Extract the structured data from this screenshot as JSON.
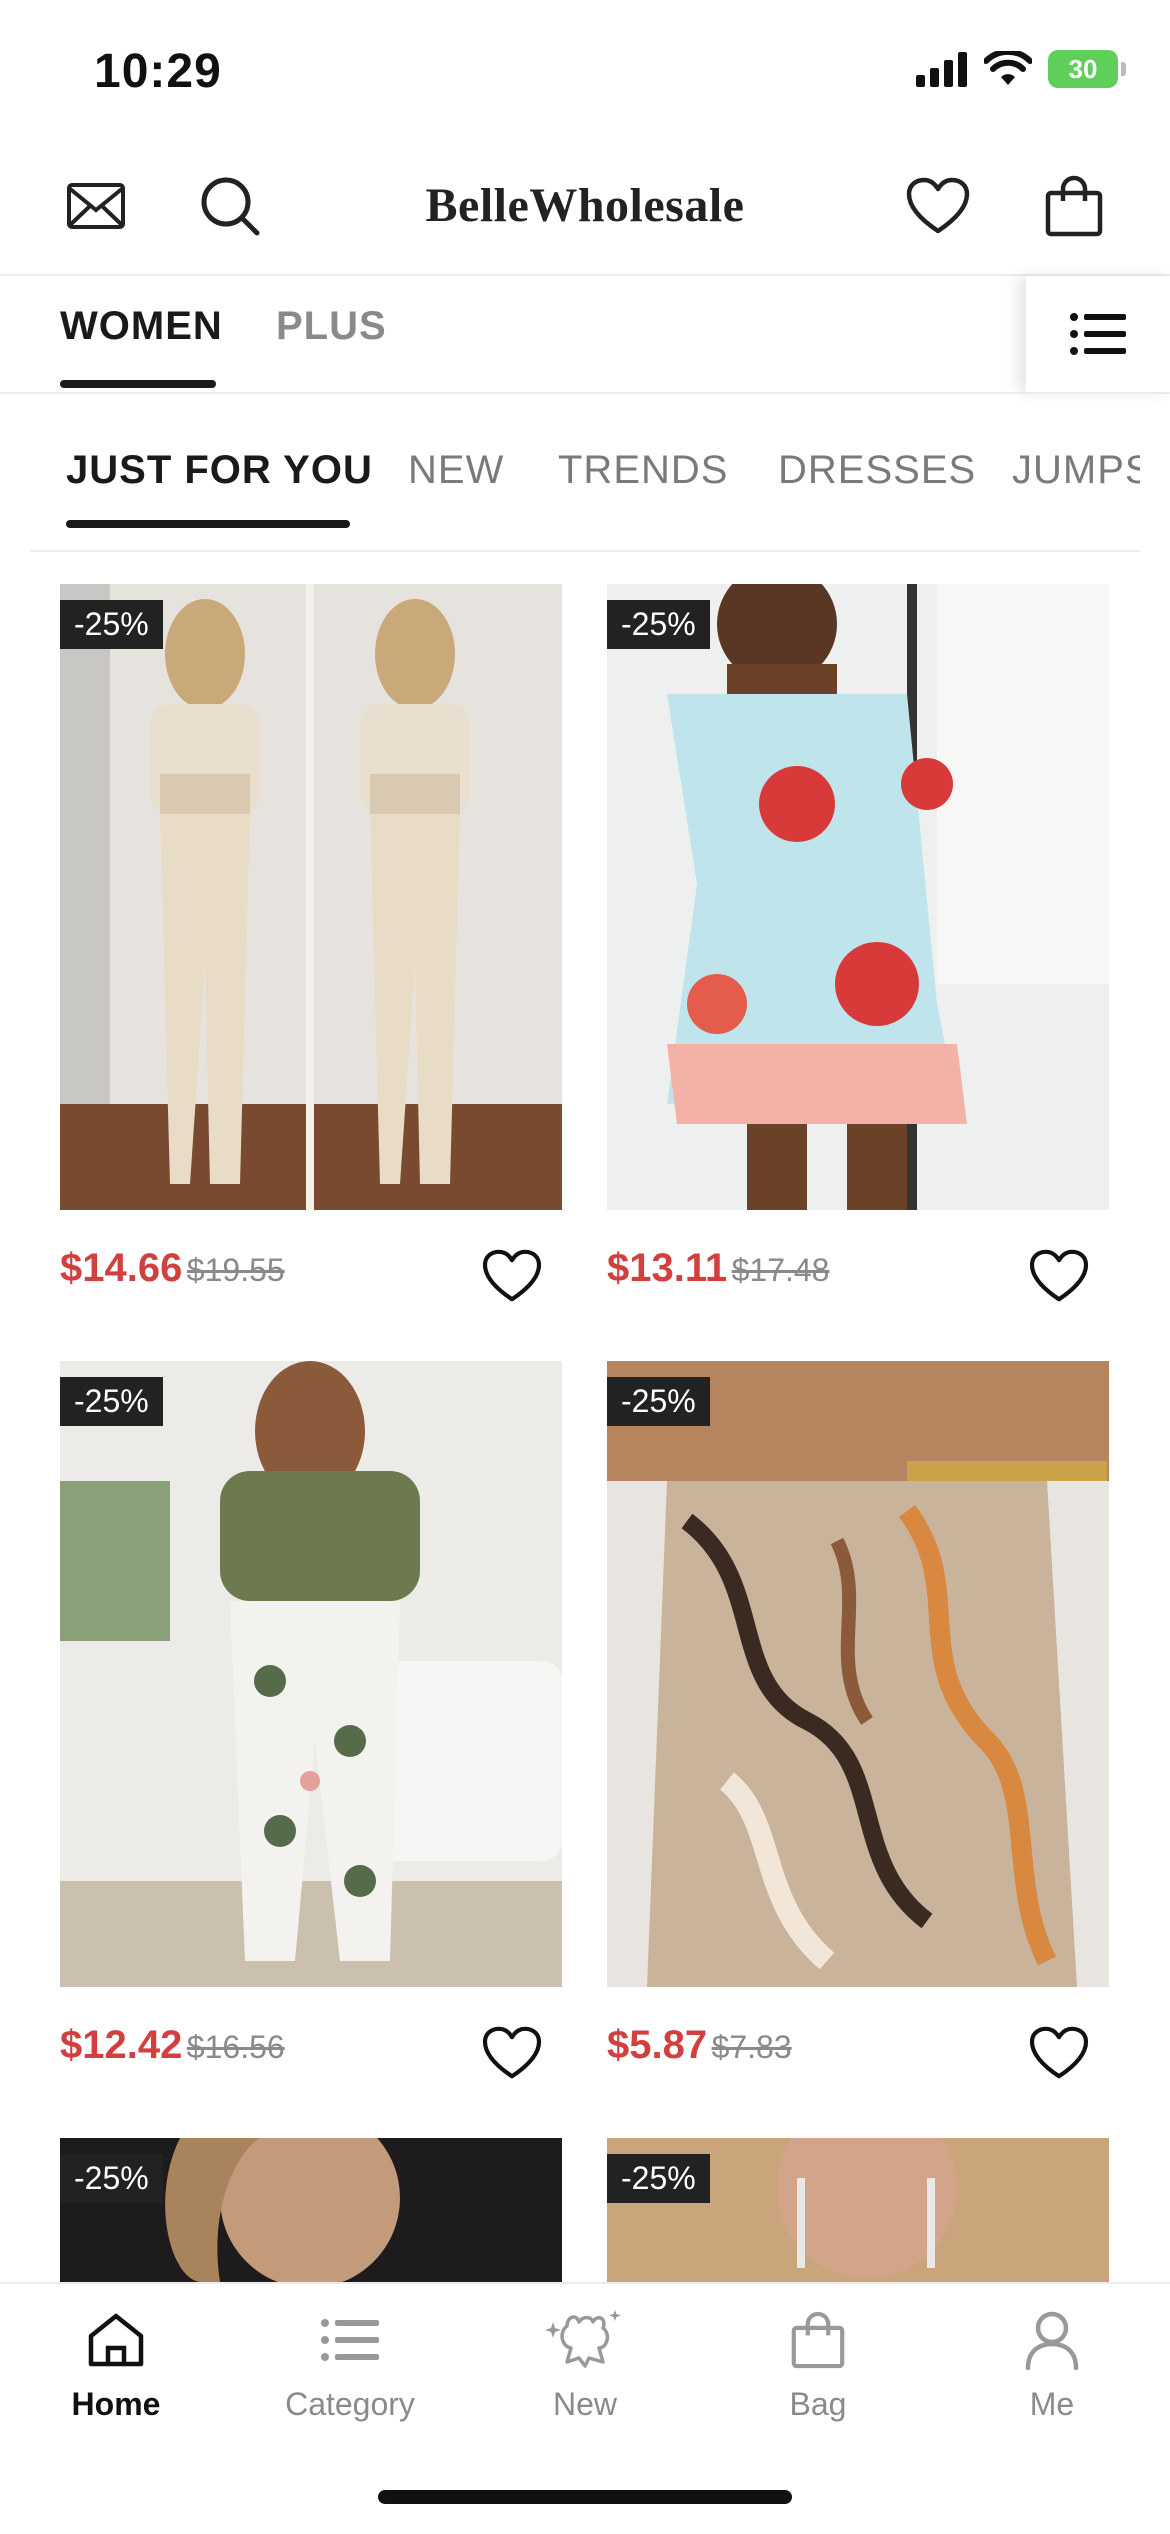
{
  "status_bar": {
    "time": "10:29",
    "battery": "30"
  },
  "header": {
    "brand": "BelleWholesale"
  },
  "gender_tabs": [
    {
      "label": "WOMEN"
    },
    {
      "label": "PLUS"
    }
  ],
  "category_tabs": [
    {
      "label": "JUST FOR YOU"
    },
    {
      "label": "NEW"
    },
    {
      "label": "TRENDS"
    },
    {
      "label": "DRESSES"
    },
    {
      "label": "JUMPS"
    }
  ],
  "products": [
    {
      "discount": "-25%",
      "price": "$14.66",
      "original_price": "$19.55"
    },
    {
      "discount": "-25%",
      "price": "$13.11",
      "original_price": "$17.48"
    },
    {
      "discount": "-25%",
      "price": "$12.42",
      "original_price": "$16.56"
    },
    {
      "discount": "-25%",
      "price": "$5.87",
      "original_price": "$7.83"
    },
    {
      "discount": "-25%"
    },
    {
      "discount": "-25%"
    }
  ],
  "bottom_nav": [
    {
      "label": "Home",
      "icon": "home-icon"
    },
    {
      "label": "Category",
      "icon": "list-icon"
    },
    {
      "label": "New",
      "icon": "sparkle-bear-icon"
    },
    {
      "label": "Bag",
      "icon": "bag-icon"
    },
    {
      "label": "Me",
      "icon": "person-icon"
    }
  ],
  "colors": {
    "price_accent": "#d23f3f",
    "active_text": "#1a1a1a",
    "inactive_text": "#8a8a8a"
  }
}
